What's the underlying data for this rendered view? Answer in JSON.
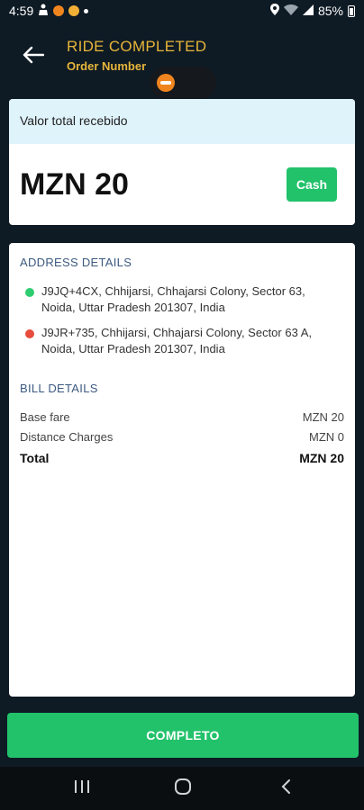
{
  "status_bar": {
    "time": "4:59",
    "battery": "85%"
  },
  "header": {
    "title": "RIDE COMPLETED",
    "subtitle": "Order Number"
  },
  "amount": {
    "label": "Valor total recebido",
    "value": "MZN 20",
    "payment_method": "Cash"
  },
  "address": {
    "section_title": "ADDRESS DETAILS",
    "pickup": "J9JQ+4CX, Chhijarsi, Chhajarsi Colony, Sector 63, Noida, Uttar Pradesh 201307, India",
    "drop": "J9JR+735, Chhijarsi, Chhajarsi Colony, Sector 63 A, Noida, Uttar Pradesh 201307, India",
    "pickup_color": "#2ecc71",
    "drop_color": "#e74c3c"
  },
  "bill": {
    "section_title": "BILL DETAILS",
    "rows": [
      {
        "label": "Base fare",
        "value": "MZN 20"
      },
      {
        "label": "Distance Charges",
        "value": "MZN 0"
      }
    ],
    "total_label": "Total",
    "total_value": "MZN 20"
  },
  "actions": {
    "complete_label": "COMPLETO"
  },
  "colors": {
    "background": "#0e1a24",
    "accent": "#e7b63a",
    "success": "#22c26b"
  },
  "icons": {
    "back": "arrow-left-icon",
    "nav_recents": "recents-icon",
    "nav_home": "home-icon",
    "nav_back": "back-chevron-icon"
  }
}
